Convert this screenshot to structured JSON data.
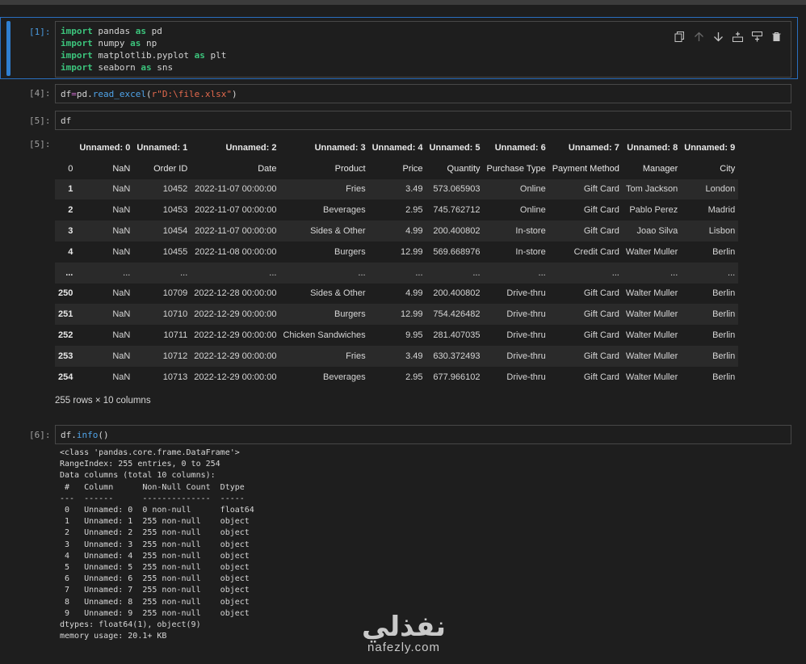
{
  "cells": [
    {
      "prompt": "[1]:",
      "code": [
        [
          [
            "kw",
            "import"
          ],
          [
            "plain",
            " pandas "
          ],
          [
            "kw",
            "as"
          ],
          [
            "plain",
            " pd"
          ]
        ],
        [
          [
            "kw",
            "import"
          ],
          [
            "plain",
            " numpy "
          ],
          [
            "kw",
            "as"
          ],
          [
            "plain",
            " np"
          ]
        ],
        [
          [
            "kw",
            "import"
          ],
          [
            "plain",
            " matplotlib.pyplot "
          ],
          [
            "kw",
            "as"
          ],
          [
            "plain",
            " plt"
          ]
        ],
        [
          [
            "kw",
            "import"
          ],
          [
            "plain",
            " seaborn "
          ],
          [
            "kw",
            "as"
          ],
          [
            "plain",
            " sns"
          ]
        ]
      ]
    },
    {
      "prompt": "[4]:",
      "code": [
        [
          [
            "plain",
            "df"
          ],
          [
            "op",
            "="
          ],
          [
            "plain",
            "pd."
          ],
          [
            "fn",
            "read_excel"
          ],
          [
            "plain",
            "("
          ],
          [
            "str",
            "r\"D:\\file.xlsx\""
          ],
          [
            "plain",
            ")"
          ]
        ]
      ]
    },
    {
      "prompt": "[5]:",
      "code": [
        [
          [
            "plain",
            "df"
          ]
        ]
      ]
    },
    {
      "prompt": "[6]:",
      "code": [
        [
          [
            "plain",
            "df."
          ],
          [
            "fn",
            "info"
          ],
          [
            "plain",
            "()"
          ]
        ]
      ]
    }
  ],
  "output_prompt": "[5]:",
  "toolbar": {
    "icons": [
      "copy-icon",
      "arrow-up-icon",
      "arrow-down-icon",
      "insert-below-icon",
      "insert-above-icon",
      "trash-icon"
    ]
  },
  "dataframe": {
    "header_top": [
      "",
      "Unnamed: 0",
      "Unnamed: 1",
      "Unnamed: 2",
      "Unnamed: 3",
      "Unnamed: 4",
      "Unnamed: 5",
      "Unnamed: 6",
      "Unnamed: 7",
      "Unnamed: 8",
      "Unnamed: 9"
    ],
    "header_row": [
      "0",
      "NaN",
      "Order ID",
      "Date",
      "Product",
      "Price",
      "Quantity",
      "Purchase Type",
      "Payment Method",
      "Manager",
      "City"
    ],
    "rows": [
      [
        "1",
        "NaN",
        "10452",
        "2022-11-07 00:00:00",
        "Fries",
        "3.49",
        "573.065903",
        "Online",
        "Gift Card",
        "Tom Jackson",
        "London"
      ],
      [
        "2",
        "NaN",
        "10453",
        "2022-11-07 00:00:00",
        "Beverages",
        "2.95",
        "745.762712",
        "Online",
        "Gift Card",
        "Pablo Perez",
        "Madrid"
      ],
      [
        "3",
        "NaN",
        "10454",
        "2022-11-07 00:00:00",
        "Sides & Other",
        "4.99",
        "200.400802",
        "In-store",
        "Gift Card",
        "Joao Silva",
        "Lisbon"
      ],
      [
        "4",
        "NaN",
        "10455",
        "2022-11-08 00:00:00",
        "Burgers",
        "12.99",
        "569.668976",
        "In-store",
        "Credit Card",
        "Walter Muller",
        "Berlin"
      ],
      [
        "...",
        "...",
        "...",
        "...",
        "...",
        "...",
        "...",
        "...",
        "...",
        "...",
        "..."
      ],
      [
        "250",
        "NaN",
        "10709",
        "2022-12-28 00:00:00",
        "Sides & Other",
        "4.99",
        "200.400802",
        "Drive-thru",
        "Gift Card",
        "Walter Muller",
        "Berlin"
      ],
      [
        "251",
        "NaN",
        "10710",
        "2022-12-29 00:00:00",
        "Burgers",
        "12.99",
        "754.426482",
        "Drive-thru",
        "Gift Card",
        "Walter Muller",
        "Berlin"
      ],
      [
        "252",
        "NaN",
        "10711",
        "2022-12-29 00:00:00",
        "Chicken Sandwiches",
        "9.95",
        "281.407035",
        "Drive-thru",
        "Gift Card",
        "Walter Muller",
        "Berlin"
      ],
      [
        "253",
        "NaN",
        "10712",
        "2022-12-29 00:00:00",
        "Fries",
        "3.49",
        "630.372493",
        "Drive-thru",
        "Gift Card",
        "Walter Muller",
        "Berlin"
      ],
      [
        "254",
        "NaN",
        "10713",
        "2022-12-29 00:00:00",
        "Beverages",
        "2.95",
        "677.966102",
        "Drive-thru",
        "Gift Card",
        "Walter Muller",
        "Berlin"
      ]
    ],
    "shape": "255 rows × 10 columns"
  },
  "info_output": [
    "<class 'pandas.core.frame.DataFrame'>",
    "RangeIndex: 255 entries, 0 to 254",
    "Data columns (total 10 columns):",
    " #   Column      Non-Null Count  Dtype  ",
    "---  ------      --------------  -----  ",
    " 0   Unnamed: 0  0 non-null      float64",
    " 1   Unnamed: 1  255 non-null    object ",
    " 2   Unnamed: 2  255 non-null    object ",
    " 3   Unnamed: 3  255 non-null    object ",
    " 4   Unnamed: 4  255 non-null    object ",
    " 5   Unnamed: 5  255 non-null    object ",
    " 6   Unnamed: 6  255 non-null    object ",
    " 7   Unnamed: 7  255 non-null    object ",
    " 8   Unnamed: 8  255 non-null    object ",
    " 9   Unnamed: 9  255 non-null    object ",
    "dtypes: float64(1), object(9)",
    "memory usage: 20.1+ KB"
  ],
  "watermark": {
    "arabic": "نفذلي",
    "latin": "nafezly.com"
  },
  "colors": {
    "keyword": "#3cc47c",
    "function": "#4fa3e8",
    "string": "#e3694d",
    "operator": "#cf6dd0",
    "active_cell": "#2f7fd1"
  }
}
